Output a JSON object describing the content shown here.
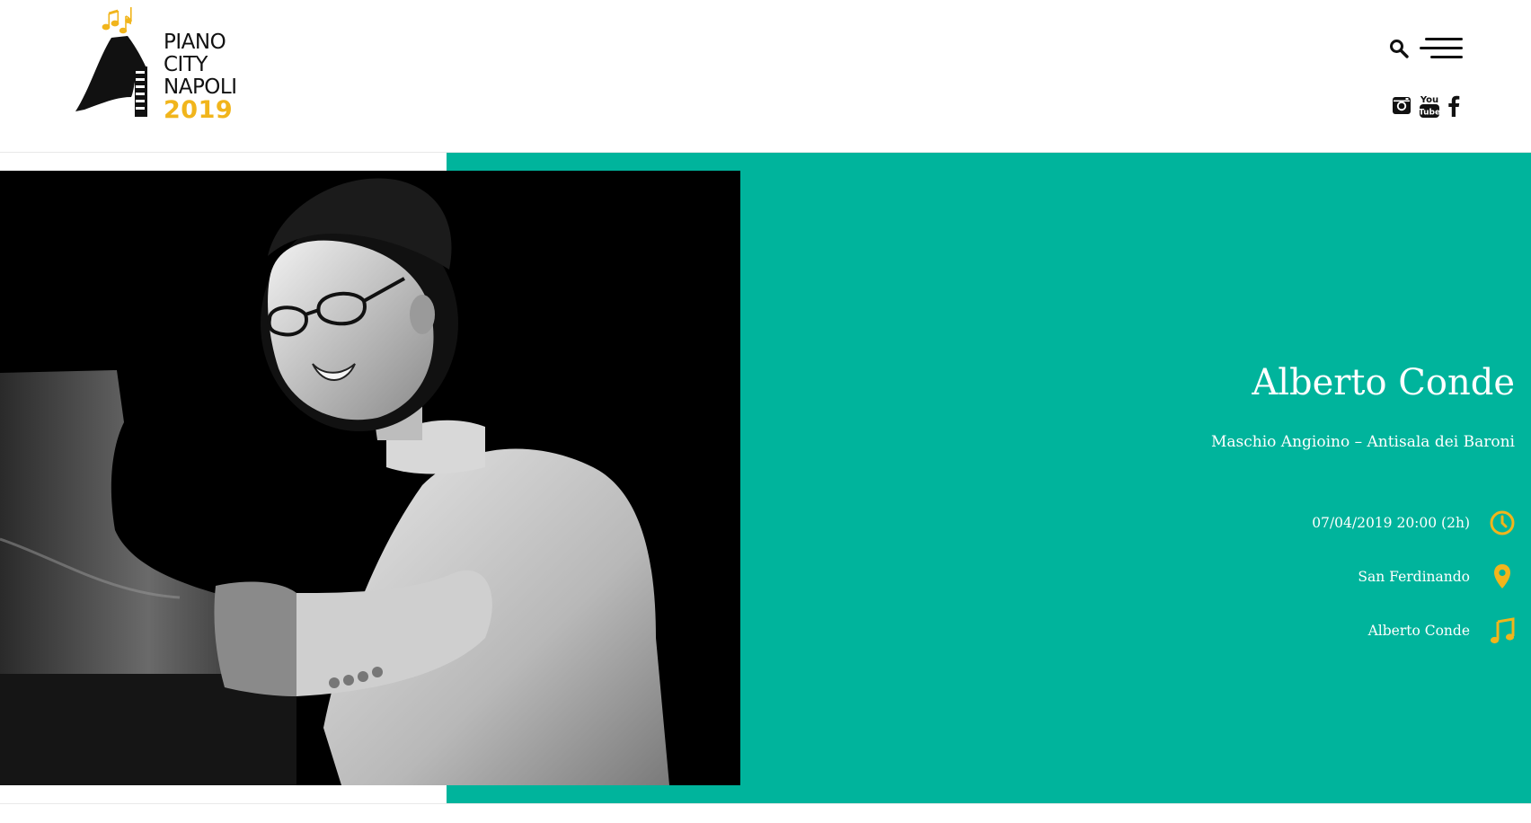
{
  "brand": {
    "line1": "PIANO",
    "line2": "CITY",
    "line3": "NAPOLI",
    "year": "2019",
    "accent": "#f1b51c"
  },
  "header": {
    "icons": [
      "search-icon",
      "menu-icon",
      "instagram-icon",
      "youtube-icon",
      "facebook-icon"
    ],
    "youtube_text_top": "You",
    "youtube_text_bottom": "Tube"
  },
  "event": {
    "title": "Alberto Conde",
    "venue": "Maschio Angioino – Antisala dei Baroni",
    "datetime": "07/04/2019 20:00 (2h)",
    "district": "San Ferdinando",
    "artist": "Alberto Conde"
  },
  "colors": {
    "band": "#00b49c",
    "icon_accent": "#f1b51c",
    "text": "#ffffff"
  }
}
